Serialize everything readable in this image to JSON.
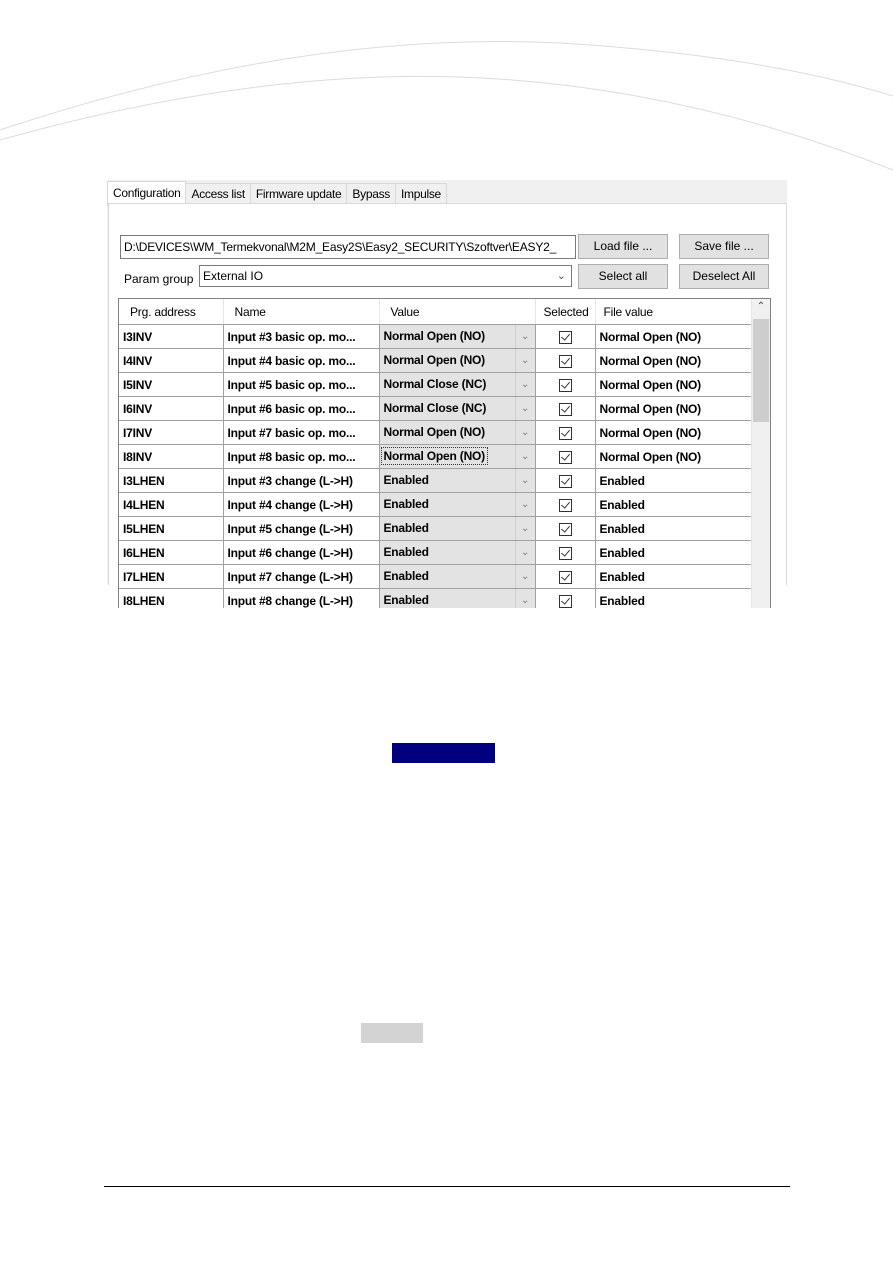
{
  "tabs": [
    {
      "label": "Configuration",
      "active": true
    },
    {
      "label": "Access list",
      "active": false
    },
    {
      "label": "Firmware update",
      "active": false
    },
    {
      "label": "Bypass",
      "active": false
    },
    {
      "label": "Impulse",
      "active": false
    }
  ],
  "file_path": "D:\\DEVICES\\WM_Termekvonal\\M2M_Easy2S\\Easy2_SECURITY\\Szoftver\\EASY2_",
  "buttons": {
    "load_file": "Load file ...",
    "save_file": "Save file ...",
    "select_all": "Select all",
    "deselect_all": "Deselect All"
  },
  "param_group": {
    "label": "Param group",
    "selected": "External IO"
  },
  "grid": {
    "columns": [
      "Prg. address",
      "Name",
      "Value",
      "Selected",
      "File value"
    ],
    "rows": [
      {
        "address": "I3INV",
        "name": "Input #3 basic op. mo...",
        "value": "Normal Open (NO)",
        "selected": true,
        "file_value": "Normal Open (NO)"
      },
      {
        "address": "I4INV",
        "name": "Input #4 basic op. mo...",
        "value": "Normal Open (NO)",
        "selected": true,
        "file_value": "Normal Open (NO)"
      },
      {
        "address": "I5INV",
        "name": "Input #5 basic op. mo...",
        "value": "Normal Close (NC)",
        "selected": true,
        "file_value": "Normal Open (NO)"
      },
      {
        "address": "I6INV",
        "name": "Input #6 basic op. mo...",
        "value": "Normal Close (NC)",
        "selected": true,
        "file_value": "Normal Open (NO)"
      },
      {
        "address": "I7INV",
        "name": "Input #7 basic op. mo...",
        "value": "Normal Open (NO)",
        "selected": true,
        "file_value": "Normal Open (NO)"
      },
      {
        "address": "I8INV",
        "name": "Input #8 basic op. mo...",
        "value": "Normal Open (NO)",
        "selected": true,
        "file_value": "Normal Open (NO)",
        "focused": true
      },
      {
        "address": "I3LHEN",
        "name": "Input #3 change (L->H)",
        "value": "Enabled",
        "selected": true,
        "file_value": "Enabled"
      },
      {
        "address": "I4LHEN",
        "name": "Input #4 change (L->H)",
        "value": "Enabled",
        "selected": true,
        "file_value": "Enabled"
      },
      {
        "address": "I5LHEN",
        "name": "Input #5 change (L->H)",
        "value": "Enabled",
        "selected": true,
        "file_value": "Enabled"
      },
      {
        "address": "I6LHEN",
        "name": "Input #6 change (L->H)",
        "value": "Enabled",
        "selected": true,
        "file_value": "Enabled"
      },
      {
        "address": "I7LHEN",
        "name": "Input #7 change (L->H)",
        "value": "Enabled",
        "selected": true,
        "file_value": "Enabled"
      },
      {
        "address": "I8LHEN",
        "name": "Input #8 change (L->H)",
        "value": "Enabled",
        "selected": true,
        "file_value": "Enabled"
      }
    ]
  },
  "icons": {
    "dropdown": "chevron-down-icon",
    "checkbox": "checkbox-checked-icon",
    "scroll_up": "chevron-up-icon"
  },
  "colors": {
    "highlight_box": "#00007f",
    "grey_box": "#d3d3d3"
  }
}
